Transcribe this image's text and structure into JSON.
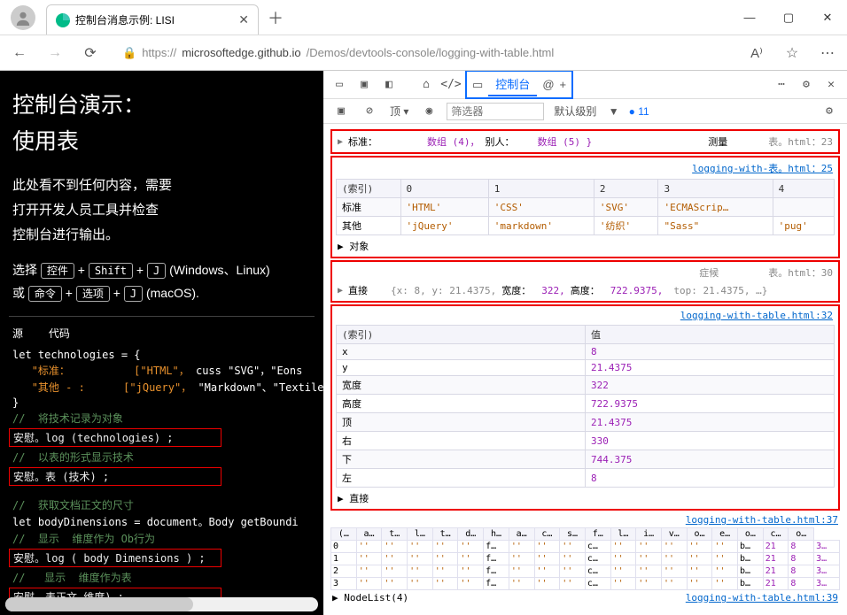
{
  "window": {
    "tab_title": "控制台消息示例: LISI",
    "url_prefix": "https://",
    "url_host": "microsoftedge.github.io",
    "url_path": "/Demos/devtools-console/logging-with-table.html"
  },
  "page": {
    "h1_line1": "控制台演示：",
    "h1_line2": "使用表",
    "p1": "此处看不到任何内容，需要",
    "p2": "打开开发人员工具并检查",
    "p3": "控制台进行输出。",
    "shortcut_pre": "选择",
    "kbd1": "控件",
    "kbd_plus": "+",
    "kbd2": "Shift",
    "kbd3": "J",
    "shortcut_os1": " (Windows、Linux)",
    "shortcut_or": "或",
    "kbd4": "命令",
    "kbd5": "选项",
    "kbd6": "J",
    "shortcut_os2": " (macOS)."
  },
  "src": {
    "hdr_src": "源",
    "hdr_code": "代码",
    "l1": "let technologies = {",
    "l2_key": "\"标准：",
    "l2_arr": "[\"HTML\"，",
    "l2_tail": "cuss \"SVG\"，\"Eons",
    "l3_key": "\"其他 - :",
    "l3_arr": "[\"jQuery\"，",
    "l3_tail": "\"Markdown\"、\"Textile-",
    "l4": "}",
    "c1": "//  将技术记录为对象",
    "b1": "安慰。log (technologies) ;",
    "c2": "//  以表的形式显示技术",
    "b2": "安慰。表 (技术) ;",
    "c3": "//  获取文档正文的尺寸",
    "l5": "let bodyDinensions = document。Body getBoundi",
    "c4": "//  显示  维度作为 Ob行为",
    "b3": "安慰。log ( body Dimensions ) ;",
    "c5": "//   显示  维度作为表",
    "b4": "安慰。表正文 维度) ;"
  },
  "devtools": {
    "tab_console": "控制台",
    "at": "@",
    "plus": "+",
    "top": "顶",
    "filter_ph": "筛选器",
    "level": "默认级别",
    "issues": "11",
    "row1": {
      "label": "标准：",
      "c1": "数组 (4)，",
      "c2": "别人：",
      "c3": "数组 (5) }",
      "rlabel": "测量",
      "src": "表。html：23"
    },
    "row2_src": "logging-with-表。html：25",
    "tbl1": {
      "head": [
        "(索引)",
        "0",
        "1",
        "2",
        "3",
        "4"
      ],
      "r1": [
        "标准",
        "'HTML'",
        "'CSS'",
        "'SVG'",
        "'ECMAScrip…",
        ""
      ],
      "r2": [
        "其他",
        "'jQuery'",
        "'markdown'",
        "'纺织'",
        "\"Sass\"",
        "'pug'"
      ],
      "foot": "▶ 对象"
    },
    "row3": {
      "label": "直接",
      "blurb": "{x: 8, y: 21.4375,",
      "kw": "宽度：",
      "v": "322,",
      "kw2": "高度：",
      "v2": "722.9375,",
      "tail": "top: 21.4375,     …}",
      "top_right": "症候",
      "src": "表。html：30"
    },
    "row4_src": "logging-with-table.html:32",
    "tbl2": {
      "head": [
        "(索引)",
        "值"
      ],
      "rows": [
        [
          "x",
          "8"
        ],
        [
          "y",
          "21.4375"
        ],
        [
          "宽度",
          "322"
        ],
        [
          "高度",
          "722.9375"
        ],
        [
          "顶",
          "21.4375"
        ],
        [
          "右",
          "330"
        ],
        [
          "下",
          "744.375"
        ],
        [
          "左",
          "8"
        ]
      ],
      "foot": "▶ 直接"
    },
    "row5_src": "logging-with-table.html:37",
    "minitbl": {
      "head": [
        "(…",
        "a…",
        "t…",
        "l…",
        "t…",
        "d…",
        "h…",
        "a…",
        "c…",
        "s…",
        "f…",
        "l…",
        "i…",
        "v…",
        "o…",
        "e…",
        "o…",
        "c…",
        "o…"
      ],
      "r0": [
        "0",
        "''",
        "''",
        "''",
        "''",
        "''",
        "f…",
        "''",
        "''",
        "''",
        "c…",
        "''",
        "''",
        "''",
        "''",
        "''",
        "b…",
        "21",
        "8",
        "3…"
      ],
      "r1": [
        "1",
        "''",
        "''",
        "''",
        "''",
        "''",
        "f…",
        "''",
        "''",
        "''",
        "c…",
        "''",
        "''",
        "''",
        "''",
        "''",
        "b…",
        "21",
        "8",
        "3…"
      ],
      "r2": [
        "2",
        "''",
        "''",
        "''",
        "''",
        "''",
        "f…",
        "''",
        "''",
        "''",
        "c…",
        "''",
        "''",
        "''",
        "''",
        "''",
        "b…",
        "21",
        "8",
        "3…"
      ],
      "r3": [
        "3",
        "''",
        "''",
        "''",
        "''",
        "''",
        "f…",
        "''",
        "''",
        "''",
        "c…",
        "''",
        "''",
        "''",
        "''",
        "''",
        "b…",
        "21",
        "8",
        "3…"
      ]
    },
    "nodelist": "▶ NodeList(4)",
    "row6_src": "logging-with-table.html:39"
  }
}
